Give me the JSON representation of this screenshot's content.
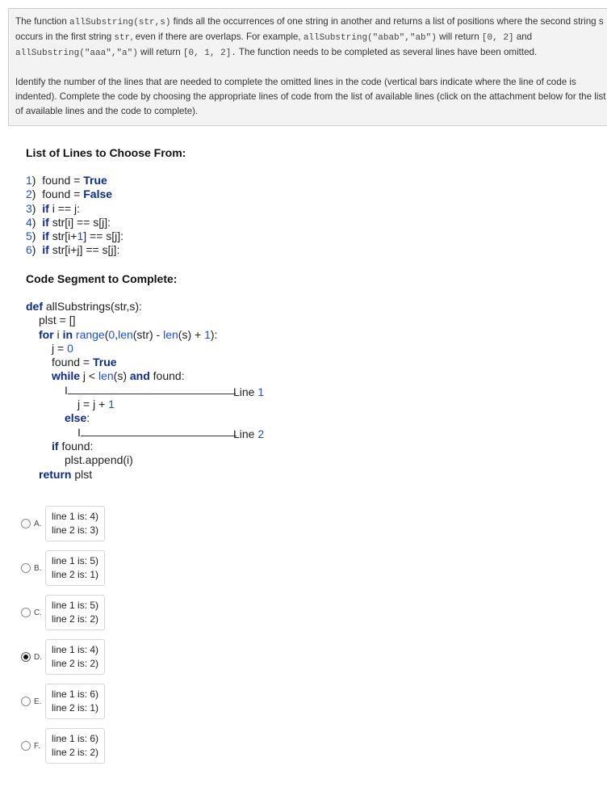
{
  "prompt": {
    "p1": [
      {
        "t": "text",
        "v": "The function "
      },
      {
        "t": "code",
        "v": "allSubstring(str,s)"
      },
      {
        "t": "text",
        "v": " finds all the occurrences of one string in another and returns a list of positions where the second string s occurs in the first string "
      },
      {
        "t": "code",
        "v": "str"
      },
      {
        "t": "text",
        "v": ", even if there are overlaps.  For example, "
      },
      {
        "t": "code",
        "v": "allSubstring(\"abab\",\"ab\")"
      },
      {
        "t": "text",
        "v": " will return "
      },
      {
        "t": "code",
        "v": "[0, 2]"
      },
      {
        "t": "text",
        "v": " and "
      },
      {
        "t": "code",
        "v": "allSubstring(\"aaa\",\"a\")"
      },
      {
        "t": "text",
        "v": " will return "
      },
      {
        "t": "code",
        "v": "[0, 1, 2]."
      },
      {
        "t": "text",
        "v": "  The function needs to be completed as several lines have been omitted."
      }
    ],
    "p2": "Identify the number of the lines that are needed to complete the omitted lines in the code (vertical bars indicate where the line of code is indented).  Complete the code by choosing the appropriate lines of code from the list of available lines (click on the attachment below for the list of available lines and the code to complete)."
  },
  "lines_heading": "List of Lines to Choose From:",
  "available_lines": [
    {
      "num": "1",
      "parts": [
        {
          "c": "",
          "v": "found = "
        },
        {
          "c": "kw",
          "v": "True"
        }
      ]
    },
    {
      "num": "2",
      "parts": [
        {
          "c": "",
          "v": "found = "
        },
        {
          "c": "kw",
          "v": "False"
        }
      ]
    },
    {
      "num": "3",
      "parts": [
        {
          "c": "kw",
          "v": "if"
        },
        {
          "c": "",
          "v": " i == j:"
        }
      ]
    },
    {
      "num": "4",
      "parts": [
        {
          "c": "kw",
          "v": "if"
        },
        {
          "c": "",
          "v": " str[i] == s[j]:"
        }
      ]
    },
    {
      "num": "5",
      "parts": [
        {
          "c": "kw",
          "v": "if"
        },
        {
          "c": "",
          "v": " str[i+"
        },
        {
          "c": "num",
          "v": "1"
        },
        {
          "c": "",
          "v": "] == s[j]:"
        }
      ]
    },
    {
      "num": "6",
      "parts": [
        {
          "c": "kw",
          "v": "if"
        },
        {
          "c": "",
          "v": " str[i+j] == s[j]:"
        }
      ]
    }
  ],
  "code_heading": "Code Segment to Complete:",
  "code_lines": [
    {
      "indent": 0,
      "parts": [
        {
          "c": "kw",
          "v": "def"
        },
        {
          "c": "",
          "v": " allSubstrings(str,s):"
        }
      ]
    },
    {
      "indent": 1,
      "parts": [
        {
          "c": "",
          "v": "plst = []"
        }
      ]
    },
    {
      "indent": 1,
      "parts": [
        {
          "c": "kw",
          "v": "for"
        },
        {
          "c": "",
          "v": " i "
        },
        {
          "c": "kw",
          "v": "in"
        },
        {
          "c": "",
          "v": " "
        },
        {
          "c": "num",
          "v": "range"
        },
        {
          "c": "",
          "v": "("
        },
        {
          "c": "num",
          "v": "0"
        },
        {
          "c": "",
          "v": ","
        },
        {
          "c": "num",
          "v": "len"
        },
        {
          "c": "",
          "v": "(str) - "
        },
        {
          "c": "num",
          "v": "len"
        },
        {
          "c": "",
          "v": "(s) + "
        },
        {
          "c": "num",
          "v": "1"
        },
        {
          "c": "",
          "v": "):"
        }
      ]
    },
    {
      "indent": 2,
      "parts": [
        {
          "c": "",
          "v": "j = "
        },
        {
          "c": "num",
          "v": "0"
        }
      ]
    },
    {
      "indent": 2,
      "parts": [
        {
          "c": "",
          "v": "found = "
        },
        {
          "c": "kw",
          "v": "True"
        }
      ]
    },
    {
      "indent": 2,
      "parts": [
        {
          "c": "kw",
          "v": "while"
        },
        {
          "c": "",
          "v": " j < "
        },
        {
          "c": "num",
          "v": "len"
        },
        {
          "c": "",
          "v": "(s) "
        },
        {
          "c": "kw",
          "v": "and"
        },
        {
          "c": "",
          "v": " found:"
        }
      ]
    },
    {
      "indent": 3,
      "blank": "1",
      "parts": [
        {
          "c": "",
          "v": "I"
        }
      ]
    },
    {
      "indent": 4,
      "parts": [
        {
          "c": "",
          "v": "j = j + "
        },
        {
          "c": "num",
          "v": "1"
        }
      ]
    },
    {
      "indent": 3,
      "parts": [
        {
          "c": "kw",
          "v": "else"
        },
        {
          "c": "",
          "v": ":"
        }
      ]
    },
    {
      "indent": 4,
      "blank": "2",
      "parts": [
        {
          "c": "",
          "v": "I"
        }
      ]
    },
    {
      "indent": 2,
      "parts": [
        {
          "c": "kw",
          "v": "if"
        },
        {
          "c": "",
          "v": " found:"
        }
      ]
    },
    {
      "indent": 3,
      "parts": [
        {
          "c": "",
          "v": "plst.append(i)"
        }
      ]
    },
    {
      "indent": 1,
      "parts": [
        {
          "c": "kw",
          "v": "return"
        },
        {
          "c": "",
          "v": " plst"
        }
      ]
    }
  ],
  "line_labels": {
    "prefix": "Line ",
    "one": "1",
    "two": "2"
  },
  "choices": [
    {
      "letter": "A.",
      "l1": "line 1 is: 4)",
      "l2": "line 2 is: 3)",
      "selected": false
    },
    {
      "letter": "B.",
      "l1": "line 1 is: 5)",
      "l2": "line 2 is: 1)",
      "selected": false
    },
    {
      "letter": "C.",
      "l1": "line 1 is: 5)",
      "l2": "line 2 is: 2)",
      "selected": false
    },
    {
      "letter": "D.",
      "l1": "line 1 is: 4)",
      "l2": "line 2 is: 2)",
      "selected": true
    },
    {
      "letter": "E.",
      "l1": "line 1 is: 6)",
      "l2": "line 2 is: 1)",
      "selected": false
    },
    {
      "letter": "F.",
      "l1": "line 1 is: 6)",
      "l2": "line 2 is: 2)",
      "selected": false
    }
  ],
  "colors": {
    "keyword": "#0b2a8f",
    "number": "#1a4fd6",
    "prompt_bg": "#f3f3f3"
  }
}
